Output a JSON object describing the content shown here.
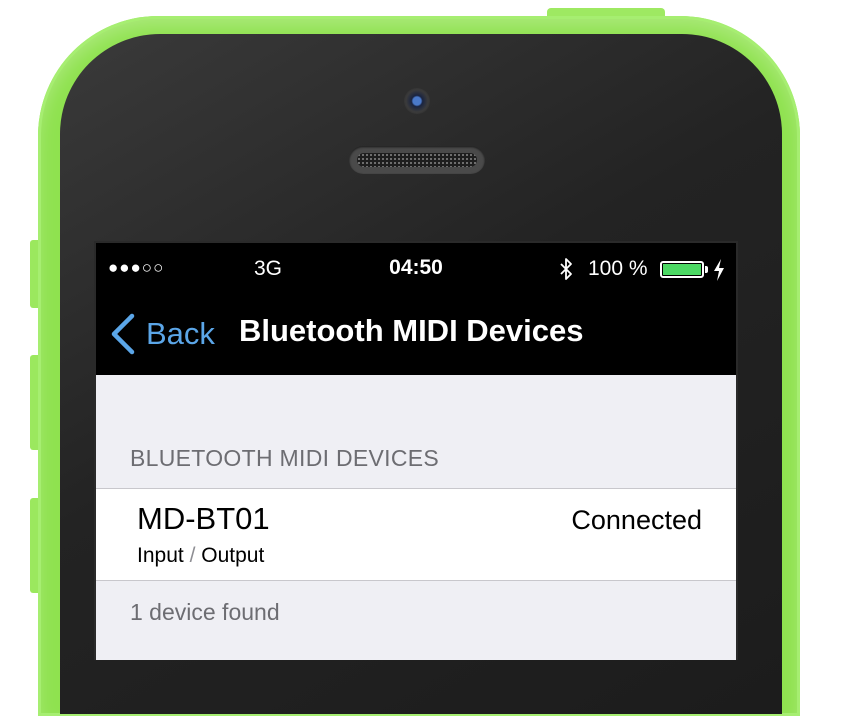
{
  "status_bar": {
    "signal": "●●●○○",
    "carrier": "3G",
    "time": "04:50",
    "battery_percent": "100 %",
    "battery_level": 1.0,
    "battery_color": "#4cd964"
  },
  "nav": {
    "back_label": "Back",
    "title": "Bluetooth MIDI Devices",
    "accent": "#5ba6e8"
  },
  "section": {
    "header": "BLUETOOTH MIDI DEVICES"
  },
  "devices": [
    {
      "name": "MD-BT01",
      "io_in": "Input",
      "io_sep": "/",
      "io_out": "Output",
      "status": "Connected"
    }
  ],
  "footer": {
    "text": "1 device found"
  },
  "icons": {
    "bluetooth": "bluetooth-icon",
    "charging": "charging-bolt-icon",
    "back": "chevron-left-icon"
  },
  "colors": {
    "phone_case": "#8fe24f",
    "background": "#efeff4"
  }
}
